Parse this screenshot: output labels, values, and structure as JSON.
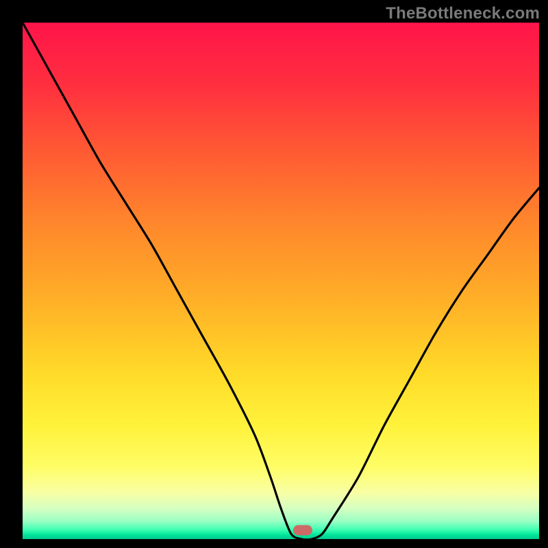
{
  "watermark": "TheBottleneck.com",
  "marker": {
    "x_frac": 0.543,
    "y_frac": 0.983,
    "color": "#cc6a67"
  },
  "chart_data": {
    "type": "line",
    "title": "",
    "xlabel": "",
    "ylabel": "",
    "xlim": [
      0,
      100
    ],
    "ylim": [
      0,
      100
    ],
    "grid": false,
    "legend": false,
    "series": [
      {
        "name": "bottleneck-curve",
        "x": [
          0,
          5,
          10,
          15,
          20,
          25,
          30,
          35,
          40,
          45,
          48,
          50,
          52,
          54,
          56,
          58,
          60,
          65,
          70,
          75,
          80,
          85,
          90,
          95,
          100
        ],
        "y": [
          100,
          91,
          82,
          73,
          65,
          57,
          48,
          39,
          30,
          20,
          12,
          6,
          1,
          0,
          0,
          1,
          4,
          12,
          22,
          31,
          40,
          48,
          55,
          62,
          68
        ]
      }
    ],
    "annotations": [
      {
        "type": "marker",
        "x": 54.3,
        "y": 1.7,
        "label": "optimal-point"
      }
    ],
    "background_gradient": {
      "direction": "vertical",
      "stops": [
        {
          "pos": 0.0,
          "color": "#ff144a"
        },
        {
          "pos": 0.55,
          "color": "#ffb327"
        },
        {
          "pos": 0.86,
          "color": "#fffd66"
        },
        {
          "pos": 0.98,
          "color": "#3dffb1"
        },
        {
          "pos": 1.0,
          "color": "#00c98f"
        }
      ]
    }
  }
}
